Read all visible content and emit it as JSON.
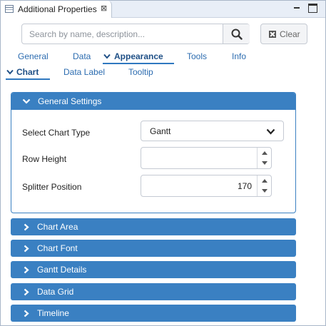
{
  "view": {
    "title": "Additional Properties",
    "close_glyph": "⊠"
  },
  "search": {
    "placeholder": "Search by name, description...",
    "value": "",
    "button_icon": "search-icon"
  },
  "clear_button": {
    "label": "Clear",
    "icon": "clear-icon"
  },
  "main_tabs": [
    {
      "label": "General",
      "active": false
    },
    {
      "label": "Data",
      "active": false
    },
    {
      "label": "Appearance",
      "active": true
    },
    {
      "label": "Tools",
      "active": false
    },
    {
      "label": "Info",
      "active": false
    }
  ],
  "sub_tabs": [
    {
      "label": "Chart",
      "active": true
    },
    {
      "label": "Data Label",
      "active": false
    },
    {
      "label": "Tooltip",
      "active": false
    }
  ],
  "general_settings": {
    "title": "General Settings",
    "expanded": true,
    "fields": {
      "chart_type": {
        "label": "Select Chart Type",
        "value": "Gantt"
      },
      "row_height": {
        "label": "Row Height",
        "value": ""
      },
      "splitter_position": {
        "label": "Splitter Position",
        "value": "170"
      }
    }
  },
  "sections": [
    {
      "label": "Chart Area"
    },
    {
      "label": "Chart Font"
    },
    {
      "label": "Gantt Details"
    },
    {
      "label": "Data Grid"
    },
    {
      "label": "Timeline"
    }
  ],
  "colors": {
    "accent": "#3a80c2",
    "tab_text": "#2c6cb0",
    "active_tab_text": "#1e4f86",
    "border": "#c5cad3"
  }
}
